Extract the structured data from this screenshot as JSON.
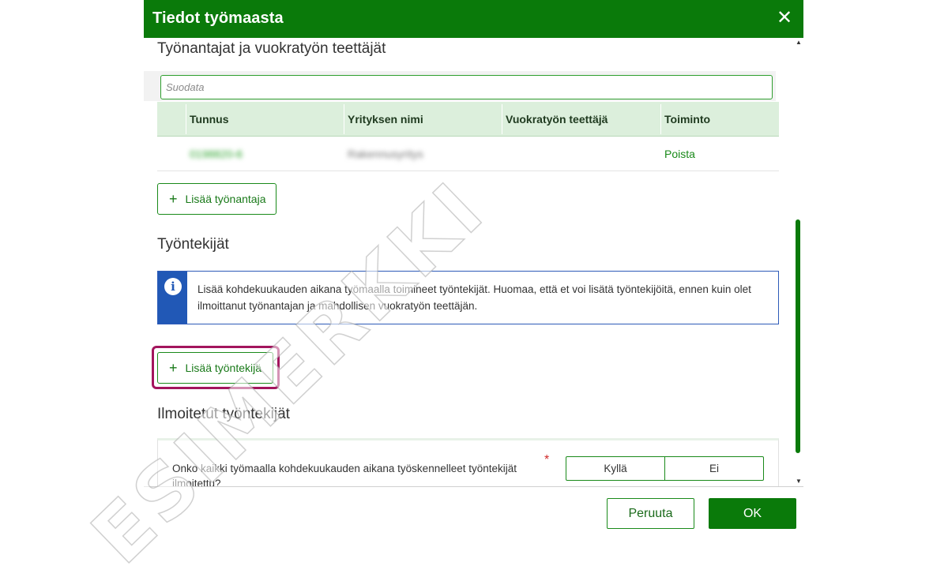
{
  "dialog": {
    "title": "Tiedot työmaasta",
    "close_glyph": "✕"
  },
  "employers": {
    "heading": "Työnantajat ja vuokratyön teettäjät",
    "filter_placeholder": "Suodata",
    "columns": [
      "Tunnus",
      "Yrityksen nimi",
      "Vuokratyön teettäjä",
      "Toiminto"
    ],
    "rows": [
      {
        "id": "0198820-6",
        "name": "Rakennusyritys",
        "lessee": "",
        "action": "Poista"
      }
    ],
    "add_button": "Lisää työnantaja"
  },
  "workers": {
    "heading": "Työntekijät",
    "info_icon": "i",
    "info_text": "Lisää kohdekuukauden aikana työmaalla toimineet työntekijät. Huomaa, että et voi lisätä työntekijöitä, ennen kuin olet ilmoittanut työnantajan ja mahdollisen vuokratyön teettäjän.",
    "add_button": "Lisää työntekijä"
  },
  "reported": {
    "heading": "Ilmoitetut työntekijät",
    "question": "Onko kaikki työmaalla kohdekuukauden aikana työskennelleet työntekijät ilmoitettu?",
    "required_mark": "*",
    "options": [
      "Kyllä",
      "Ei"
    ]
  },
  "footer": {
    "cancel": "Peruuta",
    "ok": "OK"
  },
  "watermark": "ESIMERKKI",
  "colors": {
    "brand_green": "#0a7a0a",
    "table_header": "#dcefdc",
    "info_blue": "#2158b6",
    "highlight": "#a3155d",
    "required": "#d02a2a"
  },
  "icons": {
    "close": "close-icon",
    "add": "plus-icon",
    "info": "info-icon",
    "scroll_up": "triangle-up-icon",
    "scroll_down": "triangle-down-icon"
  }
}
